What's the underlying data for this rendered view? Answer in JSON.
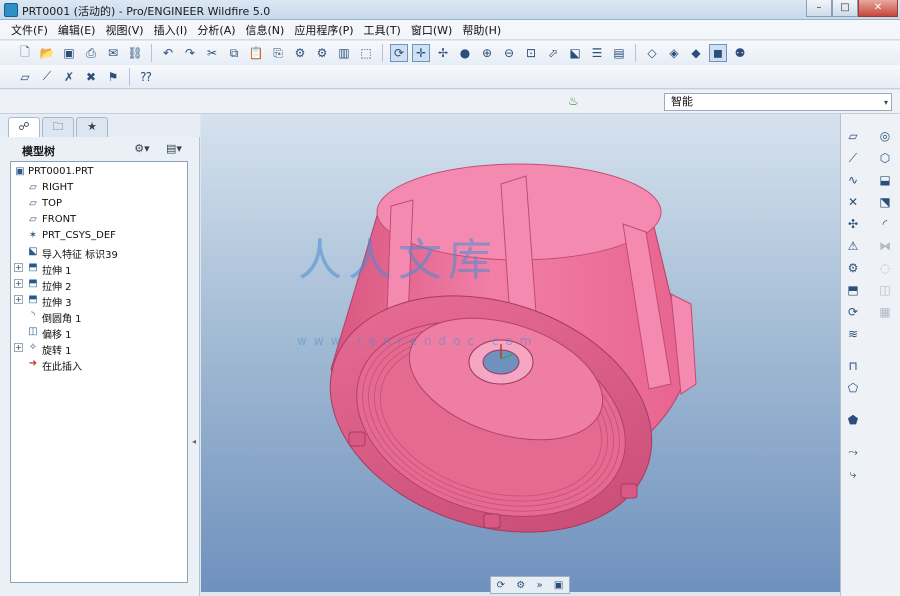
{
  "window": {
    "title": "PRT0001 (活动的) - Pro/ENGINEER Wildfire 5.0",
    "min_symbol": "–",
    "max_symbol": "□",
    "close_symbol": "✕"
  },
  "menu": [
    "文件(F)",
    "编辑(E)",
    "视图(V)",
    "插入(I)",
    "分析(A)",
    "信息(N)",
    "应用程序(P)",
    "工具(T)",
    "窗口(W)",
    "帮助(H)"
  ],
  "toolbar1": [
    {
      "name": "new-icon",
      "glyph": "🗋"
    },
    {
      "name": "open-icon",
      "glyph": "📂"
    },
    {
      "name": "save-icon",
      "glyph": "▣"
    },
    {
      "name": "print-icon",
      "glyph": "⎙"
    },
    {
      "name": "email-icon",
      "glyph": "✉"
    },
    {
      "name": "email-link-icon",
      "glyph": "⛓"
    },
    {
      "sep": true
    },
    {
      "name": "undo-icon",
      "glyph": "↶"
    },
    {
      "name": "redo-icon",
      "glyph": "↷"
    },
    {
      "name": "cut-icon",
      "glyph": "✂"
    },
    {
      "name": "copy-icon",
      "glyph": "⧉"
    },
    {
      "name": "paste-icon",
      "glyph": "📋"
    },
    {
      "name": "paste-special-icon",
      "glyph": "⎘"
    },
    {
      "name": "regenerate-icon",
      "glyph": "⚙"
    },
    {
      "name": "regen-manager-icon",
      "glyph": "⚙"
    },
    {
      "name": "find-icon",
      "glyph": "▥"
    },
    {
      "name": "select-box-icon",
      "glyph": "⬚"
    },
    {
      "sep": true
    },
    {
      "name": "repaint-icon",
      "glyph": "⟳",
      "active": true
    },
    {
      "name": "spin-center-icon",
      "glyph": "✛",
      "active": true
    },
    {
      "name": "orient-mode-icon",
      "glyph": "✢"
    },
    {
      "name": "appearance-icon",
      "glyph": "●"
    },
    {
      "name": "zoom-in-icon",
      "glyph": "⊕"
    },
    {
      "name": "zoom-out-icon",
      "glyph": "⊖"
    },
    {
      "name": "refit-icon",
      "glyph": "⊡"
    },
    {
      "name": "reorient-icon",
      "glyph": "⬀"
    },
    {
      "name": "saved-views-icon",
      "glyph": "⬕"
    },
    {
      "name": "layers-icon",
      "glyph": "☰"
    },
    {
      "name": "view-manager-icon",
      "glyph": "▤"
    },
    {
      "sep": true
    },
    {
      "name": "wireframe-icon",
      "glyph": "◇"
    },
    {
      "name": "hidden-line-icon",
      "glyph": "◈"
    },
    {
      "name": "no-hidden-icon",
      "glyph": "◆"
    },
    {
      "name": "shading-icon",
      "glyph": "◼",
      "active": true
    },
    {
      "name": "model-tree-display-icon",
      "glyph": "⚉"
    }
  ],
  "toolbar2": [
    {
      "name": "datum-plane-display-icon",
      "glyph": "▱"
    },
    {
      "name": "datum-axis-display-icon",
      "glyph": "⟋"
    },
    {
      "name": "datum-point-display-icon",
      "glyph": "✗"
    },
    {
      "name": "csys-display-icon",
      "glyph": "✖"
    },
    {
      "name": "annotation-display-icon",
      "glyph": "⚑"
    },
    {
      "sep": true
    },
    {
      "name": "help-icon",
      "glyph": "⁇"
    }
  ],
  "filter": {
    "value": "智能",
    "arrow": "▾"
  },
  "nav_tabs": [
    {
      "name": "tab-model-tree",
      "glyph": "☍",
      "active": true
    },
    {
      "name": "tab-folder-browser",
      "glyph": "🗀"
    },
    {
      "name": "tab-favorites",
      "glyph": "★"
    }
  ],
  "tree": {
    "header_label": "模型树",
    "settings_glyph": "⚙▾",
    "show_glyph": "▤▾",
    "items": [
      {
        "label": "PRT0001.PRT",
        "icon": "▣",
        "icon_name": "part-icon",
        "indent": 0,
        "expandable": false
      },
      {
        "label": "RIGHT",
        "icon": "▱",
        "icon_name": "datum-plane-icon",
        "indent": 1,
        "expandable": false
      },
      {
        "label": "TOP",
        "icon": "▱",
        "icon_name": "datum-plane-icon",
        "indent": 1,
        "expandable": false
      },
      {
        "label": "FRONT",
        "icon": "▱",
        "icon_name": "datum-plane-icon",
        "indent": 1,
        "expandable": false
      },
      {
        "label": "PRT_CSYS_DEF",
        "icon": "✶",
        "icon_name": "csys-icon",
        "indent": 1,
        "expandable": false
      },
      {
        "label": "导入特征 标识39",
        "icon": "⬕",
        "icon_name": "import-feature-icon",
        "indent": 1,
        "expandable": false
      },
      {
        "label": "拉伸 1",
        "icon": "⬒",
        "icon_name": "extrude-icon",
        "indent": 1,
        "expandable": true
      },
      {
        "label": "拉伸 2",
        "icon": "⬒",
        "icon_name": "extrude-icon",
        "indent": 1,
        "expandable": true
      },
      {
        "label": "拉伸 3",
        "icon": "⬒",
        "icon_name": "extrude-icon",
        "indent": 1,
        "expandable": true
      },
      {
        "label": "倒圆角 1",
        "icon": "◝",
        "icon_name": "round-icon",
        "indent": 1,
        "expandable": false
      },
      {
        "label": "偏移 1",
        "icon": "◫",
        "icon_name": "offset-icon",
        "indent": 1,
        "expandable": false
      },
      {
        "label": "旋转 1",
        "icon": "✧",
        "icon_name": "revolve-icon",
        "indent": 1,
        "expandable": true
      },
      {
        "label": "在此插入",
        "icon": "➜",
        "icon_name": "insert-here-icon",
        "indent": 1,
        "expandable": false
      }
    ],
    "expand_symbol": "+"
  },
  "watermark": {
    "text": "人人文库",
    "url": "www.renrendoc.com"
  },
  "minibar": [
    "⟳",
    "⚙",
    "»",
    "▣"
  ],
  "right_toolbar": [
    {
      "name": "datum-plane-tool-icon",
      "glyph": "▱",
      "col": 0
    },
    {
      "name": "hole-tool-icon",
      "glyph": "◎",
      "col": 1
    },
    {
      "name": "datum-axis-tool-icon",
      "glyph": "⟋",
      "col": 0
    },
    {
      "name": "shell-tool-icon",
      "glyph": "⬡",
      "col": 1
    },
    {
      "name": "sketch-tool-icon",
      "glyph": "∿",
      "col": 0
    },
    {
      "name": "rib-tool-icon",
      "glyph": "⬓",
      "col": 1
    },
    {
      "name": "datum-point-tool-icon",
      "glyph": "✕",
      "col": 0
    },
    {
      "name": "draft-tool-icon",
      "glyph": "⬔",
      "col": 1
    },
    {
      "name": "csys-tool-icon",
      "glyph": "✣",
      "col": 0
    },
    {
      "name": "round-tool-icon",
      "glyph": "◜",
      "col": 1
    },
    {
      "name": "analysis-feature-icon",
      "glyph": "⚠",
      "col": 0
    },
    {
      "name": "mirror-tool-icon",
      "glyph": "⧓",
      "col": 1,
      "dim": true
    },
    {
      "name": "insert-pattern-icon",
      "glyph": "⚙",
      "col": 0
    },
    {
      "name": "merge-tool-icon",
      "glyph": "◌",
      "col": 1,
      "dim": true
    },
    {
      "name": "extrude-tool-icon",
      "glyph": "⬒",
      "col": 0
    },
    {
      "name": "trim-tool-icon",
      "glyph": "◫",
      "col": 1,
      "dim": true
    },
    {
      "name": "revolve-tool-icon",
      "glyph": "⟳",
      "col": 0
    },
    {
      "name": "pattern-tool-icon",
      "glyph": "▦",
      "col": 1,
      "dim": true
    },
    {
      "name": "variable-sweep-icon",
      "glyph": "≋",
      "col": 0
    },
    {
      "name": "boundary-blend-icon",
      "glyph": "⊓",
      "col": 0
    },
    {
      "name": "style-tool-icon",
      "glyph": "⬠",
      "col": 0
    },
    {
      "name": "warp-tool-icon",
      "glyph": "⬟",
      "col": 0
    },
    {
      "name": "freestyle-tool-icon",
      "glyph": "⤳",
      "col": 0
    },
    {
      "name": "sweep-tool-icon",
      "glyph": "⤷",
      "col": 0
    }
  ]
}
